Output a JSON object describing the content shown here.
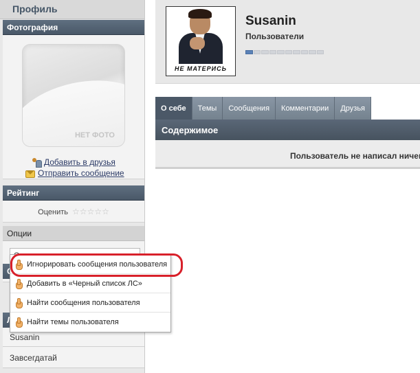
{
  "sidebar": {
    "title": "Профиль",
    "photo_section": "Фотография",
    "photo_placeholder": "НЕТ ФОТО",
    "add_friend": "Добавить в друзья",
    "send_message": "Отправить сообщение",
    "rating_section": "Рейтинг",
    "rate_label": "Оценить",
    "stars": "☆☆☆☆☆",
    "options_section": "Опции",
    "options_select_value": "Опции",
    "hidden_head_1": "С",
    "hidden_head_2": "Л",
    "items": [
      "Susanin",
      "Завсегдатай"
    ]
  },
  "dropdown": {
    "items": [
      "Игнорировать сообщения пользователя",
      "Добавить в «Черный список ЛС»",
      "Найти сообщения пользователя",
      "Найти темы пользователя"
    ]
  },
  "profile": {
    "username": "Susanin",
    "group": "Пользователи",
    "avatar_caption": "НЕ МАТЕРИСЬ",
    "reputation_filled": 1,
    "reputation_total": 10
  },
  "tabs": [
    "О себе",
    "Темы",
    "Сообщения",
    "Комментарии",
    "Друзья"
  ],
  "content": {
    "header": "Содержимое",
    "message": "Пользователь не написал ничего"
  },
  "colors": {
    "highlight": "#d8202a",
    "header_dark": "#4b5867",
    "rep_on": "#5b82b8"
  }
}
